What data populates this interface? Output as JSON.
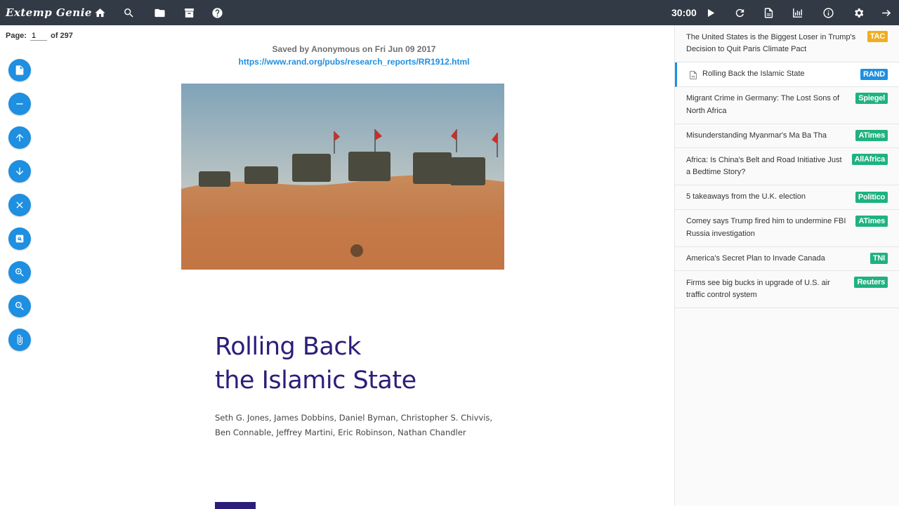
{
  "app": {
    "brand": "Extemp Genie",
    "timer": "30:00"
  },
  "page_indicator": {
    "label": "Page:",
    "current": "1",
    "of_label": "of 297"
  },
  "document": {
    "saved_by": "Saved by Anonymous on Fri Jun 09 2017",
    "url": "https://www.rand.org/pubs/research_reports/RR1912.html",
    "title_line1": "Rolling Back",
    "title_line2": "the Islamic State",
    "authors_line1": "Seth G. Jones, James Dobbins, Daniel Byman, Christopher S. Chivvis,",
    "authors_line2": "Ben Connable, Jeffrey Martini, Eric Robinson, Nathan Chandler"
  },
  "top_icons": [
    "home-icon",
    "search-icon",
    "folder-icon",
    "archive-icon",
    "help-icon",
    "play-icon",
    "refresh-icon",
    "pdf-icon",
    "chart-icon",
    "info-icon",
    "gear-icon",
    "logout-icon"
  ],
  "side_buttons": [
    "document-icon",
    "minus-icon",
    "arrow-up-icon",
    "arrow-down-icon",
    "close-icon",
    "find-in-page-icon",
    "zoom-in-icon",
    "zoom-out-icon",
    "attachment-icon"
  ],
  "articles": [
    {
      "title": "The United States is the Biggest Loser in Trump's Decision to Quit Paris Climate Pact",
      "source": "TAC",
      "color": "#f0ad1e"
    },
    {
      "title": "Rolling Back the Islamic State",
      "source": "RAND",
      "color": "#1e8fe1",
      "active": true
    },
    {
      "title": "Migrant Crime in Germany: The Lost Sons of North Africa",
      "source": "Spiegel",
      "color": "#1fb27f"
    },
    {
      "title": "Misunderstanding Myanmar's Ma Ba Tha",
      "source": "ATimes",
      "color": "#1fb27f"
    },
    {
      "title": "Africa: Is China's Belt and Road Initiative Just a Bedtime Story?",
      "source": "AllAfrica",
      "color": "#1fb27f"
    },
    {
      "title": "5 takeaways from the U.K. election",
      "source": "Politico",
      "color": "#1fb27f"
    },
    {
      "title": "Comey says Trump fired him to undermine FBI Russia investigation",
      "source": "ATimes",
      "color": "#1fb27f"
    },
    {
      "title": "America's Secret Plan to Invade Canada",
      "source": "TNI",
      "color": "#1fb27f"
    },
    {
      "title": "Firms see big bucks in upgrade of U.S. air traffic control system",
      "source": "Reuters",
      "color": "#1fb27f"
    }
  ]
}
